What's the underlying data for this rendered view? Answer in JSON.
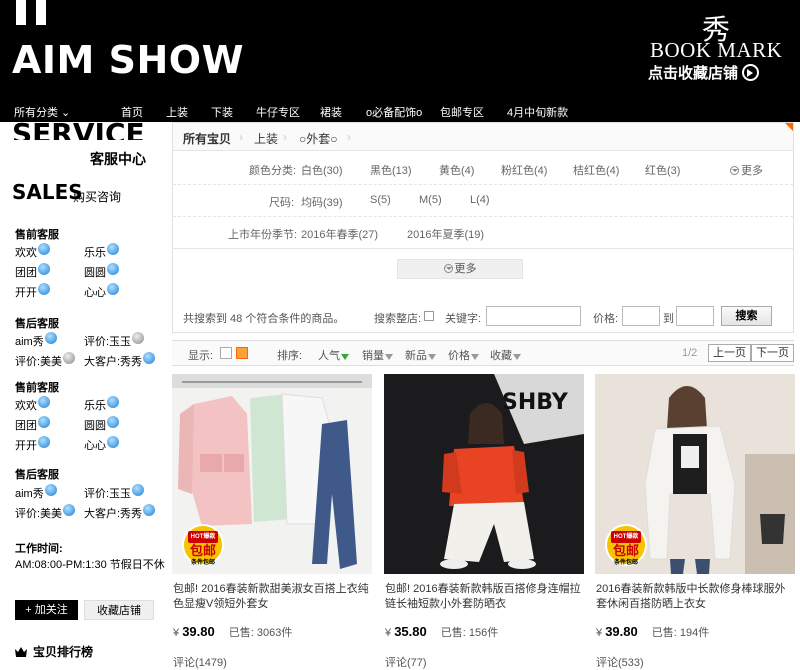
{
  "header": {
    "logo_title": "AIM SHOW",
    "bookmark_char": "秀",
    "bookmark_text": "BOOK MARK",
    "bookmark_fav": "点击收藏店铺",
    "nav": [
      "所有分类 ⌄",
      "首页",
      "上装",
      "下装",
      "牛仔专区",
      "裙装",
      "o必备配饰o",
      "包邮专区",
      "4月中旬新款"
    ]
  },
  "sidebar": {
    "service_big": "SERVICE",
    "service_cn": "客服中心",
    "sales_big": "SALES",
    "sales_cn": "购买咨询",
    "groups": [
      {
        "title": "售前客服",
        "agents": [
          "欢欢",
          "乐乐",
          "团团",
          "圆圆",
          "开开",
          "心心"
        ]
      },
      {
        "title": "售后客服",
        "agents": [
          "aim秀",
          "评价:玉玉",
          "评价:美美",
          "大客户:秀秀"
        ]
      },
      {
        "title": "售前客服",
        "agents": [
          "欢欢",
          "乐乐",
          "团团",
          "圆圆",
          "开开",
          "心心"
        ]
      },
      {
        "title": "售后客服",
        "agents": [
          "aim秀",
          "评价:玉玉",
          "评价:美美",
          "大客户:秀秀"
        ]
      }
    ],
    "worktime_title": "工作时间:",
    "worktime": "AM:08:00-PM:1:30 节假日不休",
    "follow_label": "+ 加关注",
    "fav_label": "收藏店铺",
    "rank_label": "宝贝排行榜"
  },
  "filter": {
    "breadcrumb": [
      "所有宝贝",
      "上装",
      "○外套○"
    ],
    "color_label": "颜色分类:",
    "colors": [
      "白色(30)",
      "黑色(13)",
      "黄色(4)",
      "粉红色(4)",
      "桔红色(4)",
      "红色(3)"
    ],
    "color_more": "更多",
    "size_label": "尺码:",
    "sizes": [
      "均码(39)",
      "S(5)",
      "M(5)",
      "L(4)"
    ],
    "season_label": "上市年份季节:",
    "seasons": [
      "2016年春季(27)",
      "2016年夏季(19)"
    ],
    "more": "更多",
    "result_text": "共搜索到 48 个符合条件的商品。",
    "store_search": "搜索整店:",
    "keyword_label": "关键字:",
    "price_label": "价格:",
    "to": "到",
    "search_btn": "搜索"
  },
  "sortbar": {
    "display_label": "显示:",
    "sort_label": "排序:",
    "sorts": [
      "人气",
      "销量",
      "新品",
      "价格",
      "收藏"
    ],
    "page": "1/2",
    "prev": "上一页",
    "next": "下一页"
  },
  "products": [
    {
      "title": "包邮! 2016春装新款甜美淑女百搭上衣纯色显瘦V领短外套女",
      "price": "39.80",
      "sold": "已售: 3063件",
      "reviews": "评论(1479)",
      "badge_hot": "HOT爆款",
      "badge_main": "包邮",
      "badge_sub": "条件包邮"
    },
    {
      "title": "包邮! 2016春装新款韩版百搭修身连帽拉链长袖短款小外套防晒衣",
      "price": "35.80",
      "sold": "已售: 156件",
      "reviews": "评论(77)",
      "badge_hot": "",
      "badge_main": "",
      "badge_sub": ""
    },
    {
      "title": "2016春装新款韩版中长款修身棒球服外套休闲百搭防晒上衣女",
      "price": "39.80",
      "sold": "已售: 194件",
      "reviews": "评论(533)",
      "badge_hot": "HOT爆款",
      "badge_main": "包邮",
      "badge_sub": "条件包邮"
    }
  ],
  "currency": "¥"
}
